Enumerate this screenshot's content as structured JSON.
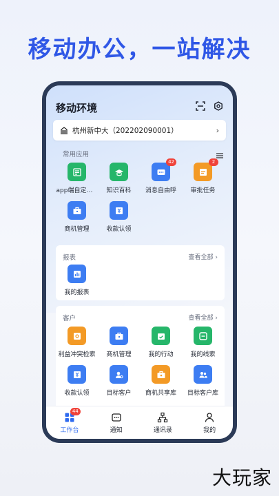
{
  "headline": "移动办公，一站解决",
  "app": {
    "title": "移动环境",
    "org": "杭州新中大（202202090001）"
  },
  "common": {
    "title": "常用应用",
    "items": [
      {
        "label": "app端自定义...",
        "icon": "form-icon",
        "color": "#26b66a"
      },
      {
        "label": "知识百科",
        "icon": "graduation-cap-icon",
        "color": "#26b66a"
      },
      {
        "label": "消息自由呼",
        "icon": "message-icon",
        "color": "#3d7df2",
        "badge": "42"
      },
      {
        "label": "审批任务",
        "icon": "approval-icon",
        "color": "#f39a26",
        "badge": "2"
      },
      {
        "label": "商机管理",
        "icon": "briefcase-icon",
        "color": "#3d7df2"
      },
      {
        "label": "收款认领",
        "icon": "payment-icon",
        "color": "#3d7df2"
      }
    ]
  },
  "report": {
    "title": "报表",
    "more": "查看全部",
    "items": [
      {
        "label": "我的报表",
        "icon": "bar-chart-icon",
        "color": "#3d7df2"
      }
    ]
  },
  "customer": {
    "title": "客户",
    "more": "查看全部",
    "items": [
      {
        "label": "利益冲突检索",
        "icon": "search-doc-icon",
        "color": "#f39a26"
      },
      {
        "label": "商机管理",
        "icon": "briefcase-icon",
        "color": "#3d7df2"
      },
      {
        "label": "我的行动",
        "icon": "calendar-check-icon",
        "color": "#26b66a"
      },
      {
        "label": "我的线索",
        "icon": "link-icon",
        "color": "#26b66a"
      },
      {
        "label": "收款认领",
        "icon": "payment-icon",
        "color": "#3d7df2"
      },
      {
        "label": "目标客户",
        "icon": "user-target-icon",
        "color": "#3d7df2"
      },
      {
        "label": "商机共享库",
        "icon": "share-briefcase-icon",
        "color": "#f39a26"
      },
      {
        "label": "目标客户库",
        "icon": "users-icon",
        "color": "#3d7df2"
      }
    ]
  },
  "tabs": [
    {
      "label": "工作台",
      "icon": "grid-icon",
      "badge": "44",
      "active": true
    },
    {
      "label": "通知",
      "icon": "chat-icon"
    },
    {
      "label": "通讯录",
      "icon": "org-chart-icon"
    },
    {
      "label": "我的",
      "icon": "person-icon"
    }
  ],
  "watermark": "大玩家"
}
